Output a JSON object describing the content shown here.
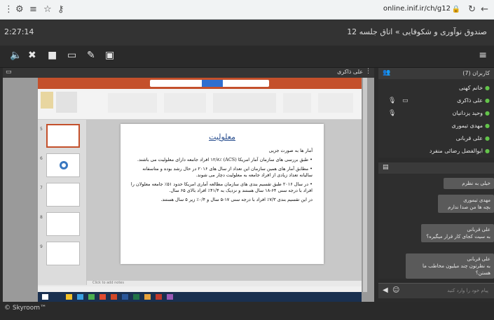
{
  "browser": {
    "url": "online.inif.ir/ch/g12"
  },
  "topbar": {
    "timer": "2:27:14",
    "title": "صندوق نوآوری و شکوفایی » اتاق جلسه 12"
  },
  "share_panel": {
    "presenter": "علی ذاکری"
  },
  "slide": {
    "title": "معلولیت",
    "subtitle": "آمار ها به صورت جزیی",
    "bullets": [
      "• طبق بررسی های سازمان آمار امریکا (ACS) ۱۲/۸٪ افراد جامعه دارای معلولیت می باشند.",
      "• مطابق آمار های همین سازمان این تعداد از سال های ۲۰۱۶ در حال رشد بوده و متاسفانه سالیانه تعداد زیادی از افراد جامعه به معلولیت دچار می شوند.",
      "• در سال ۲۰۱۶ طبق تقسیم بندی های سازمان مطالعه آماری امریکا حدود ۵۱٪ جامعه معلولان را افراد با درجه سنی ۶۴-۱۸ سال هستند و نزدیک به ۴۱/۴٪ افراد بالای ۶۵ سال.",
      "در این تقسیم بندی ۷/۳٪ افراد با درجه سنی ۱۷-۵ سال و ۰/۴٪ زیر ۵ سال هستند."
    ],
    "notes_placeholder": "Click to add notes"
  },
  "users": {
    "header": "کاربران (7)",
    "list": [
      "خانم کهنی",
      "علی ذاکری",
      "وحید یزدانیان",
      "مهدی تیموری",
      "علی قربانی",
      "ابوالفضل رضائی منفرد"
    ]
  },
  "chat": {
    "messages": [
      "خیلی به نظرم",
      "مهدی تیموری\nبچه ها من صدا ندارم",
      "علی قربانی\nبه سیت کجای کار قرار میگیره؟",
      "علی قربانی\nبه نظرتون چند میلیون مخاطب ما هستن؟"
    ],
    "input_placeholder": "پیام خود را وارد کنید"
  },
  "footer": {
    "brand": "© Skyroom™"
  },
  "colors": {
    "ppt_ribbon": "#c4502b",
    "online_green": "#63c44a",
    "dark_bg": "#2e2e2e"
  }
}
